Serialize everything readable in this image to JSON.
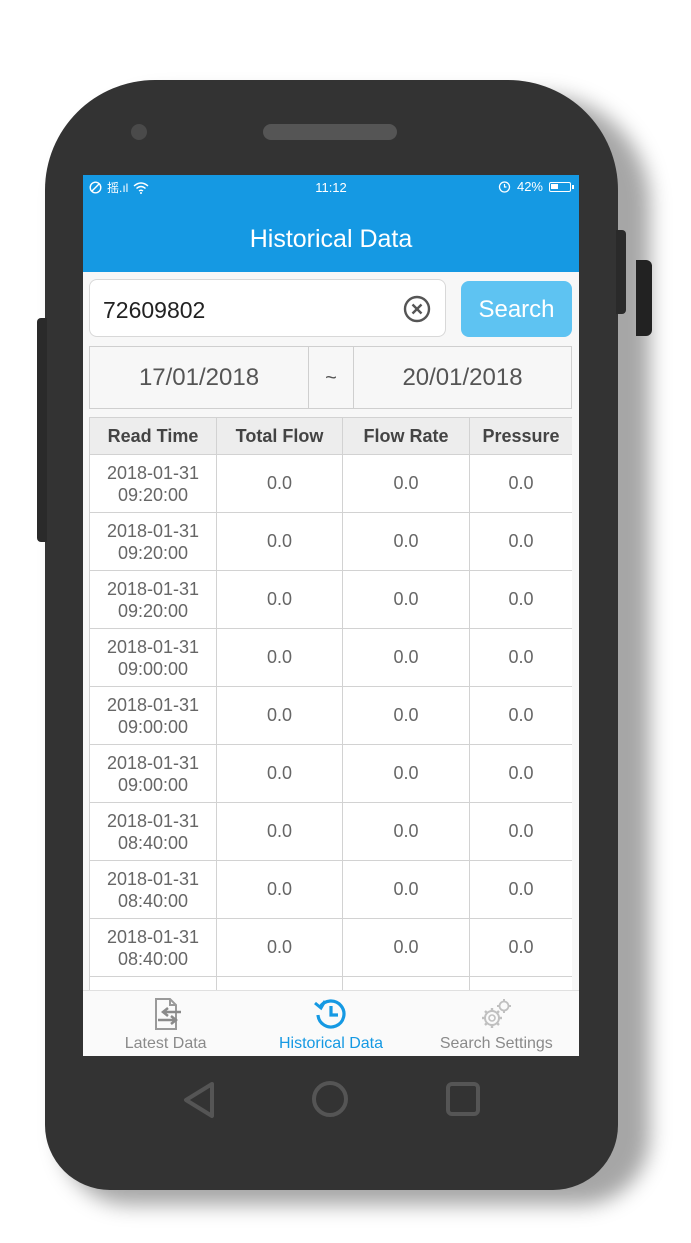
{
  "status_bar": {
    "left_icons": [
      "blocked-icon",
      "signal-icon",
      "wifi-icon"
    ],
    "signal_text": "摇.ıl",
    "time": "11:12",
    "alarm_icon": "alarm-icon",
    "battery_percent": "42%",
    "battery_level": 0.42
  },
  "appbar": {
    "title": "Historical Data"
  },
  "search": {
    "value": "72609802",
    "button_label": "Search"
  },
  "date_range": {
    "from": "17/01/2018",
    "separator": "~",
    "to": "20/01/2018"
  },
  "table": {
    "headers": [
      "Read Time",
      "Total Flow",
      "Flow Rate",
      "Pressure"
    ],
    "rows": [
      {
        "date": "2018-01-31",
        "time": "09:20:00",
        "total_flow": "0.0",
        "flow_rate": "0.0",
        "pressure": "0.0"
      },
      {
        "date": "2018-01-31",
        "time": "09:20:00",
        "total_flow": "0.0",
        "flow_rate": "0.0",
        "pressure": "0.0"
      },
      {
        "date": "2018-01-31",
        "time": "09:20:00",
        "total_flow": "0.0",
        "flow_rate": "0.0",
        "pressure": "0.0"
      },
      {
        "date": "2018-01-31",
        "time": "09:00:00",
        "total_flow": "0.0",
        "flow_rate": "0.0",
        "pressure": "0.0"
      },
      {
        "date": "2018-01-31",
        "time": "09:00:00",
        "total_flow": "0.0",
        "flow_rate": "0.0",
        "pressure": "0.0"
      },
      {
        "date": "2018-01-31",
        "time": "09:00:00",
        "total_flow": "0.0",
        "flow_rate": "0.0",
        "pressure": "0.0"
      },
      {
        "date": "2018-01-31",
        "time": "08:40:00",
        "total_flow": "0.0",
        "flow_rate": "0.0",
        "pressure": "0.0"
      },
      {
        "date": "2018-01-31",
        "time": "08:40:00",
        "total_flow": "0.0",
        "flow_rate": "0.0",
        "pressure": "0.0"
      },
      {
        "date": "2018-01-31",
        "time": "08:40:00",
        "total_flow": "0.0",
        "flow_rate": "0.0",
        "pressure": "0.0"
      },
      {
        "date": "",
        "time": "",
        "total_flow": "",
        "flow_rate": "",
        "pressure": ""
      }
    ]
  },
  "tabs": [
    {
      "label": "Latest Data",
      "icon": "latest-data-icon",
      "active": false
    },
    {
      "label": "Historical Data",
      "icon": "history-icon",
      "active": true
    },
    {
      "label": "Search Settings",
      "icon": "gear-icon",
      "active": false
    }
  ],
  "colors": {
    "primary": "#1599e3",
    "search_button": "#5ec3f2",
    "phone_body": "#333333"
  }
}
